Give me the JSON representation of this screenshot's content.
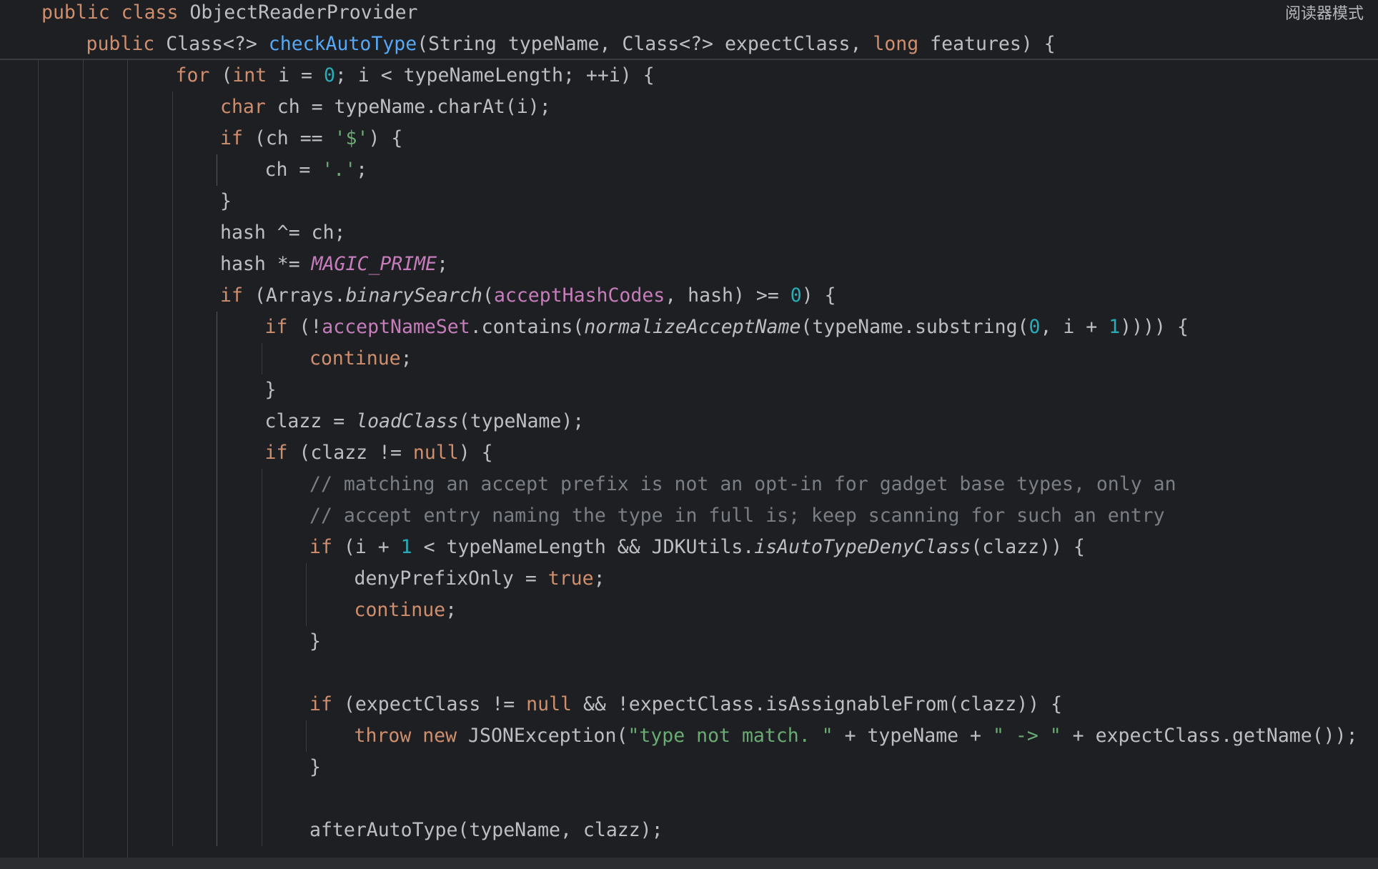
{
  "reader_mode_label": "阅读器模式",
  "colors": {
    "background": "#1e1f22",
    "text": "#bcbec4",
    "keyword": "#cf8e6d",
    "number": "#2aacb8",
    "string": "#6aab73",
    "field": "#c77dbb",
    "method_declaration": "#56a8f5",
    "comment": "#7a7e85"
  },
  "sticky_header": [
    {
      "tokens": [
        {
          "t": "public class ",
          "c": "kw"
        },
        {
          "t": "ObjectReaderProvider",
          "c": "pln"
        }
      ]
    },
    {
      "tokens": [
        {
          "t": "public ",
          "c": "kw"
        },
        {
          "t": "Class<?> ",
          "c": "pln"
        },
        {
          "t": "checkAutoType",
          "c": "fn"
        },
        {
          "t": "(String typeName, Class<?> expectClass, ",
          "c": "pln"
        },
        {
          "t": "long ",
          "c": "kw"
        },
        {
          "t": "features) {",
          "c": "pln"
        }
      ]
    }
  ],
  "code_lines": [
    {
      "indent": 3,
      "tokens": [
        {
          "t": "for ",
          "c": "kw"
        },
        {
          "t": "(",
          "c": "pln"
        },
        {
          "t": "int ",
          "c": "kw"
        },
        {
          "t": "i = ",
          "c": "pln"
        },
        {
          "t": "0",
          "c": "num"
        },
        {
          "t": "; i < typeNameLength; ++i) {",
          "c": "pln"
        }
      ]
    },
    {
      "indent": 4,
      "tokens": [
        {
          "t": "char ",
          "c": "kw"
        },
        {
          "t": "ch = typeName.charAt(i);",
          "c": "pln"
        }
      ]
    },
    {
      "indent": 4,
      "tokens": [
        {
          "t": "if ",
          "c": "kw"
        },
        {
          "t": "(ch == ",
          "c": "pln"
        },
        {
          "t": "'$'",
          "c": "str"
        },
        {
          "t": ") {",
          "c": "pln"
        }
      ]
    },
    {
      "indent": 5,
      "tokens": [
        {
          "t": "ch = ",
          "c": "pln"
        },
        {
          "t": "'.'",
          "c": "str"
        },
        {
          "t": ";",
          "c": "pln"
        }
      ]
    },
    {
      "indent": 4,
      "tokens": [
        {
          "t": "}",
          "c": "pln"
        }
      ]
    },
    {
      "indent": 4,
      "tokens": [
        {
          "t": "hash ^= ch;",
          "c": "pln"
        }
      ]
    },
    {
      "indent": 4,
      "tokens": [
        {
          "t": "hash *= ",
          "c": "pln"
        },
        {
          "t": "MAGIC_PRIME",
          "c": "cst"
        },
        {
          "t": ";",
          "c": "pln"
        }
      ]
    },
    {
      "indent": 4,
      "tokens": [
        {
          "t": "if ",
          "c": "kw"
        },
        {
          "t": "(Arrays.",
          "c": "pln"
        },
        {
          "t": "binarySearch",
          "c": "ital"
        },
        {
          "t": "(",
          "c": "pln"
        },
        {
          "t": "acceptHashCodes",
          "c": "fld"
        },
        {
          "t": ", hash) >= ",
          "c": "pln"
        },
        {
          "t": "0",
          "c": "num"
        },
        {
          "t": ") {",
          "c": "pln"
        }
      ]
    },
    {
      "indent": 5,
      "tokens": [
        {
          "t": "if ",
          "c": "kw"
        },
        {
          "t": "(!",
          "c": "pln"
        },
        {
          "t": "acceptNameSet",
          "c": "fld"
        },
        {
          "t": ".contains(",
          "c": "pln"
        },
        {
          "t": "normalizeAcceptName",
          "c": "ital"
        },
        {
          "t": "(typeName.substring(",
          "c": "pln"
        },
        {
          "t": "0",
          "c": "num"
        },
        {
          "t": ", i + ",
          "c": "pln"
        },
        {
          "t": "1",
          "c": "num"
        },
        {
          "t": ")))) {",
          "c": "pln"
        }
      ]
    },
    {
      "indent": 6,
      "tokens": [
        {
          "t": "continue",
          "c": "kw"
        },
        {
          "t": ";",
          "c": "pln"
        }
      ]
    },
    {
      "indent": 5,
      "tokens": [
        {
          "t": "}",
          "c": "pln"
        }
      ]
    },
    {
      "indent": 5,
      "tokens": [
        {
          "t": "clazz = ",
          "c": "pln"
        },
        {
          "t": "loadClass",
          "c": "ital"
        },
        {
          "t": "(typeName);",
          "c": "pln"
        }
      ]
    },
    {
      "indent": 5,
      "tokens": [
        {
          "t": "if ",
          "c": "kw"
        },
        {
          "t": "(clazz != ",
          "c": "pln"
        },
        {
          "t": "null",
          "c": "kw"
        },
        {
          "t": ") {",
          "c": "pln"
        }
      ]
    },
    {
      "indent": 6,
      "tokens": [
        {
          "t": "// matching an accept prefix is not an opt-in for gadget base types, only an",
          "c": "cmt"
        }
      ]
    },
    {
      "indent": 6,
      "tokens": [
        {
          "t": "// accept entry naming the type in full is; keep scanning for such an entry",
          "c": "cmt"
        }
      ]
    },
    {
      "indent": 6,
      "tokens": [
        {
          "t": "if ",
          "c": "kw"
        },
        {
          "t": "(i + ",
          "c": "pln"
        },
        {
          "t": "1",
          "c": "num"
        },
        {
          "t": " < typeNameLength && JDKUtils.",
          "c": "pln"
        },
        {
          "t": "isAutoTypeDenyClass",
          "c": "ital"
        },
        {
          "t": "(clazz)) {",
          "c": "pln"
        }
      ]
    },
    {
      "indent": 7,
      "tokens": [
        {
          "t": "denyPrefixOnly = ",
          "c": "pln"
        },
        {
          "t": "true",
          "c": "kw"
        },
        {
          "t": ";",
          "c": "pln"
        }
      ]
    },
    {
      "indent": 7,
      "tokens": [
        {
          "t": "continue",
          "c": "kw"
        },
        {
          "t": ";",
          "c": "pln"
        }
      ]
    },
    {
      "indent": 6,
      "tokens": [
        {
          "t": "}",
          "c": "pln"
        }
      ]
    },
    {
      "indent": 6,
      "tokens": []
    },
    {
      "indent": 6,
      "tokens": [
        {
          "t": "if ",
          "c": "kw"
        },
        {
          "t": "(expectClass != ",
          "c": "pln"
        },
        {
          "t": "null ",
          "c": "kw"
        },
        {
          "t": "&& !expectClass.isAssignableFrom(clazz)) {",
          "c": "pln"
        }
      ]
    },
    {
      "indent": 7,
      "tokens": [
        {
          "t": "throw new ",
          "c": "kw"
        },
        {
          "t": "JSONException(",
          "c": "pln"
        },
        {
          "t": "\"type not match. \"",
          "c": "str"
        },
        {
          "t": " + typeName + ",
          "c": "pln"
        },
        {
          "t": "\" -> \"",
          "c": "str"
        },
        {
          "t": " + expectClass.getName());",
          "c": "pln"
        }
      ]
    },
    {
      "indent": 6,
      "tokens": [
        {
          "t": "}",
          "c": "pln"
        }
      ]
    },
    {
      "indent": 6,
      "tokens": []
    },
    {
      "indent": 6,
      "tokens": [
        {
          "t": "afterAutoType(typeName, clazz);",
          "c": "pln"
        }
      ]
    }
  ]
}
